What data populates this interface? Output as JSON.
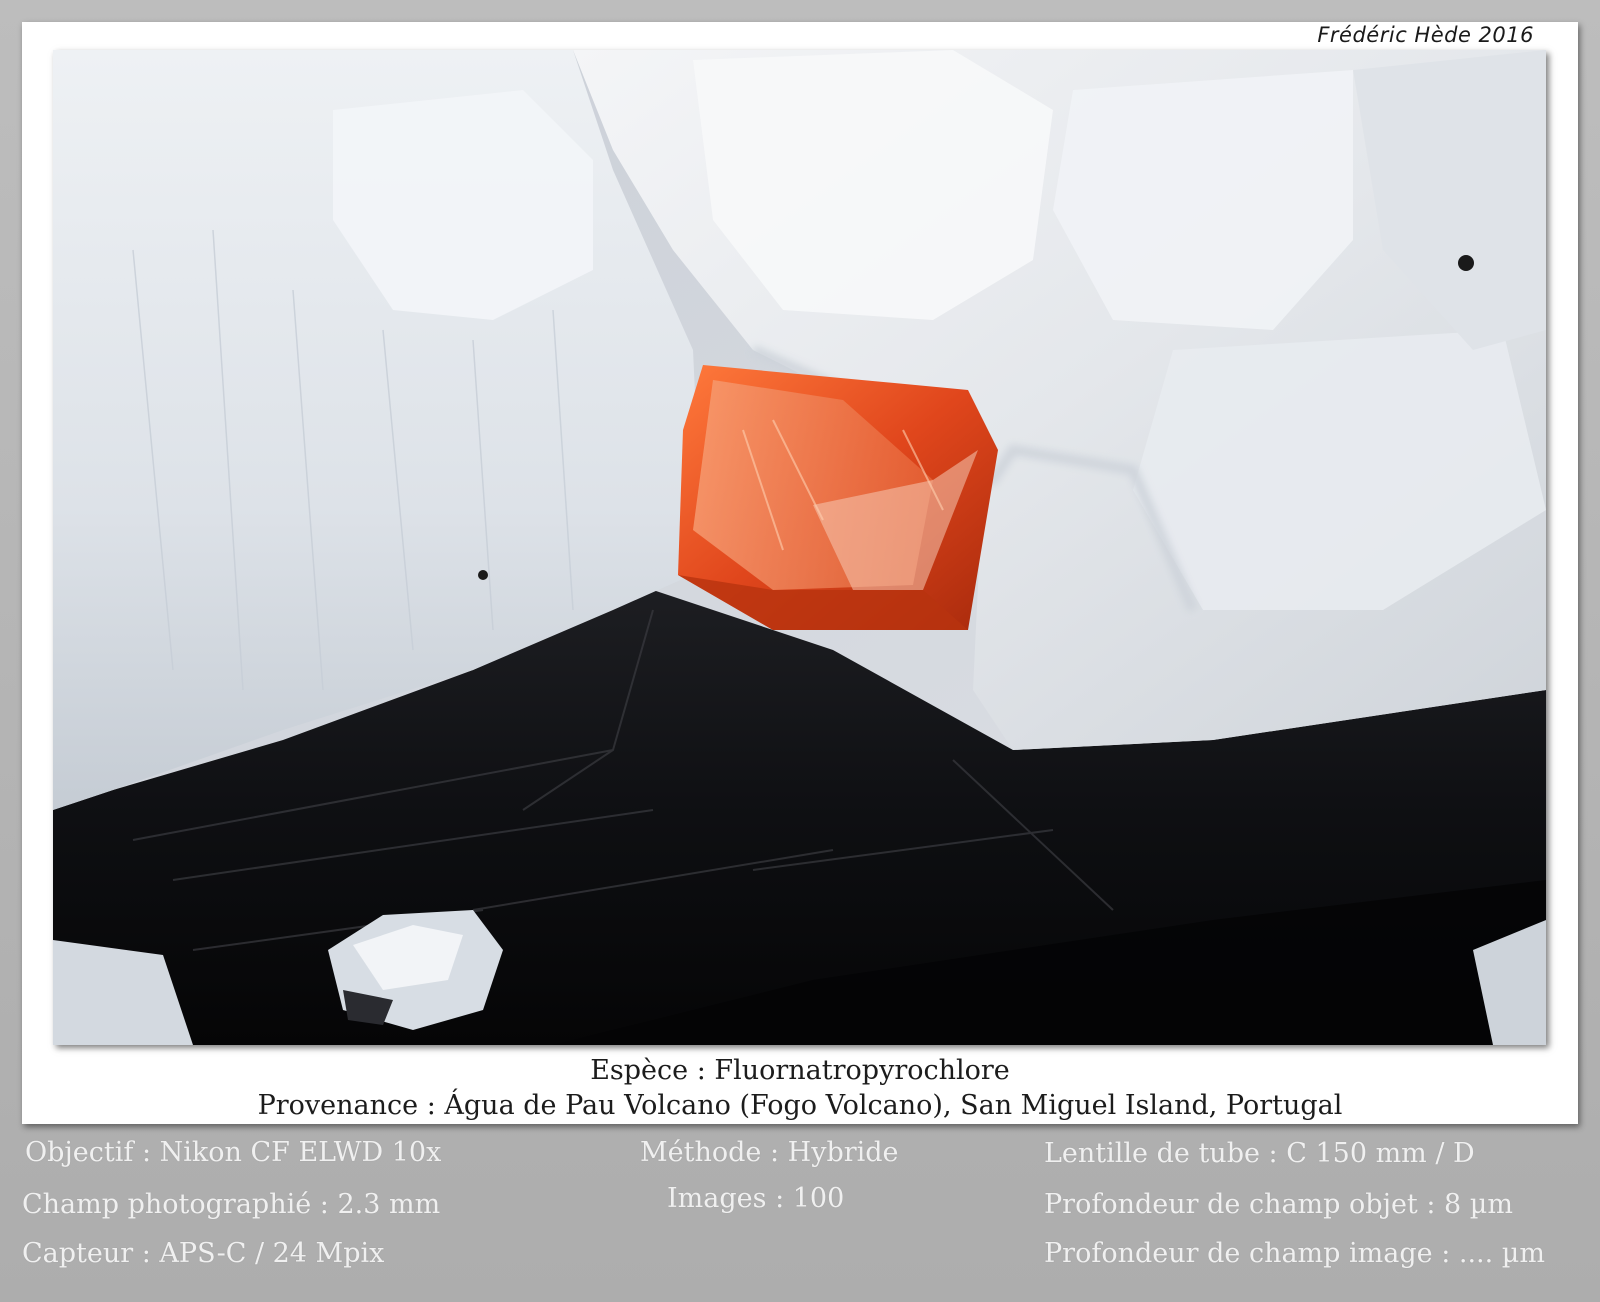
{
  "signature": "Frédéric Hède 2016",
  "caption": {
    "species": "Espèce : Fluornatropyrochlore",
    "origin": "Provenance : Água de Pau Volcano (Fogo Volcano),  San Miguel Island, Portugal"
  },
  "meta": {
    "objective": "Objectif : Nikon CF ELWD 10x",
    "field": "Champ photographié : 2.3 mm",
    "sensor": "Capteur : APS-C / 24 Mpix",
    "method": "Méthode : Hybride",
    "images": "Images : 100",
    "tube_lens": "Lentille de tube : C 150 mm / D",
    "dof_object": "Profondeur de champ objet : 8 µm",
    "dof_image": "Profondeur de champ image : .... µm"
  },
  "colors": {
    "crystal": "#e0461c",
    "matrix": "#0d0d0f",
    "white_crystals": "#e6e9ed",
    "frame": "#b4b4b4"
  }
}
